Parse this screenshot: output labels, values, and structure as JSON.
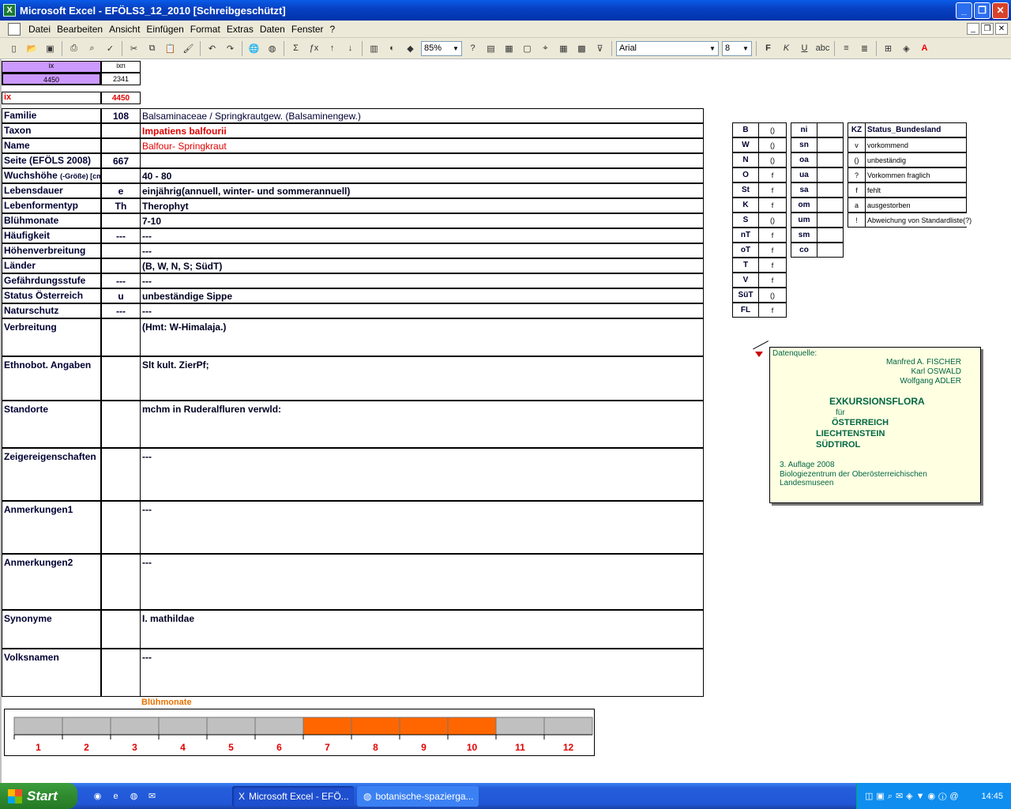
{
  "window": {
    "title": "Microsoft Excel - EFÖLS3_12_2010  [Schreibgeschützt]"
  },
  "menu": [
    "Datei",
    "Bearbeiten",
    "Ansicht",
    "Einfügen",
    "Format",
    "Extras",
    "Daten",
    "Fenster",
    "?"
  ],
  "toolbar": {
    "zoom": "85%",
    "font": "Arial",
    "size": "8"
  },
  "idbox": {
    "ix_header": "ix",
    "ixn_header": "ixn",
    "ix_value": "4450",
    "ixn_value": "2341",
    "ix_label": "ix",
    "ix_value2": "4450"
  },
  "rows": [
    {
      "label": "Familie",
      "code": "108",
      "value": "Balsaminaceae  /  Springkrautgew. (Balsaminengew.)"
    },
    {
      "label": "Taxon",
      "code": "",
      "value": "Impatiens balfourii"
    },
    {
      "label": "Name",
      "code": "",
      "value": "Balfour- Springkraut"
    },
    {
      "label": "Seite (EFÖLS 2008)",
      "code": "667",
      "value": ""
    },
    {
      "label": "Wuchshöhe",
      "label_small": "(-Größe) [cm]",
      "code": "",
      "value": " 40 - 80"
    },
    {
      "label": "Lebensdauer",
      "code": "e",
      "value": "einjährig(annuell, winter- und sommerannuell)"
    },
    {
      "label": "Lebenformentyp",
      "code": "Th",
      "value": "Therophyt"
    },
    {
      "label": "Blühmonate",
      "code": "",
      "value": " 7-10"
    },
    {
      "label": "Häufigkeit",
      "code": "---",
      "value": " ---"
    },
    {
      "label": "Höhenverbreitung",
      "code": "",
      "value": " ---"
    },
    {
      "label": "Länder",
      "code": "",
      "value": "(B, W, N, S; SüdT)"
    },
    {
      "label": "Gefährdungsstufe",
      "code": "---",
      "value": "   ---"
    },
    {
      "label": "Status Österreich",
      "code": "u",
      "value": "unbeständige Sippe"
    },
    {
      "label": "Naturschutz",
      "code": "---",
      "value": " ---"
    }
  ],
  "bigrows": [
    {
      "label": "Verbreitung",
      "value": "(Hmt: W-Himalaja.)"
    },
    {
      "label": "Ethnobot. Angaben",
      "value": "Slt kult. ZierPf;"
    },
    {
      "label": "Standorte",
      "value": "mchm in Ruderalfluren verwld:"
    },
    {
      "label": "Zeigereigenschaften",
      "value": "---"
    },
    {
      "label": "Anmerkungen1",
      "value": "---"
    },
    {
      "label": "Anmerkungen2",
      "value": "---"
    },
    {
      "label": "Synonyme",
      "value": "I. mathildae"
    },
    {
      "label": "Volksnamen",
      "value": "---"
    }
  ],
  "laender": [
    {
      "k": "B",
      "v": "()"
    },
    {
      "k": "W",
      "v": "()"
    },
    {
      "k": "N",
      "v": "()"
    },
    {
      "k": "O",
      "v": "f"
    },
    {
      "k": "St",
      "v": "f"
    },
    {
      "k": "K",
      "v": "f"
    },
    {
      "k": "S",
      "v": "()"
    },
    {
      "k": "nT",
      "v": "f"
    },
    {
      "k": "oT",
      "v": "f"
    },
    {
      "k": "T",
      "v": "f"
    },
    {
      "k": "V",
      "v": "f"
    },
    {
      "k": "SüT",
      "v": "()"
    },
    {
      "k": "FL",
      "v": "f"
    }
  ],
  "hoehen": [
    "ni",
    "sn",
    "oa",
    "ua",
    "sa",
    "om",
    "um",
    "sm",
    "co"
  ],
  "status_legend": {
    "header_kz": "KZ",
    "header_label": "Status_Bundesland",
    "items": [
      {
        "k": "v",
        "t": "vorkommend"
      },
      {
        "k": "()",
        "t": "unbeständig"
      },
      {
        "k": "?",
        "t": "Vorkommen fraglich"
      },
      {
        "k": "f",
        "t": "fehlt"
      },
      {
        "k": "a",
        "t": "ausgestorben"
      },
      {
        "k": "!",
        "t": "Abweichung von Standardliste(?)"
      }
    ]
  },
  "note": {
    "label": "Datenquelle:",
    "authors": [
      "Manfred A. FISCHER",
      "Karl OSWALD",
      "Wolfgang ADLER"
    ],
    "t1": "EXKURSIONSFLORA",
    "t2": "für",
    "t3": "ÖSTERREICH",
    "t4": "LIECHTENSTEIN",
    "t5": "SÜDTIROL",
    "ed": "3. Auflage 2008",
    "pub": "Biologiezentrum der Oberösterreichischen Landesmuseen"
  },
  "months": {
    "title": "Blühmonate",
    "labels": [
      "1",
      "2",
      "3",
      "4",
      "5",
      "6",
      "7",
      "8",
      "9",
      "10",
      "11",
      "12"
    ],
    "active": [
      7,
      8,
      9,
      10
    ],
    "active_color": "#ff6600",
    "inactive_color": "#c0c0c0"
  },
  "taskbar": {
    "start": "Start",
    "tasks": [
      "Microsoft Excel - EFÖ...",
      "botanische-spazierga..."
    ],
    "clock": "14:45"
  }
}
